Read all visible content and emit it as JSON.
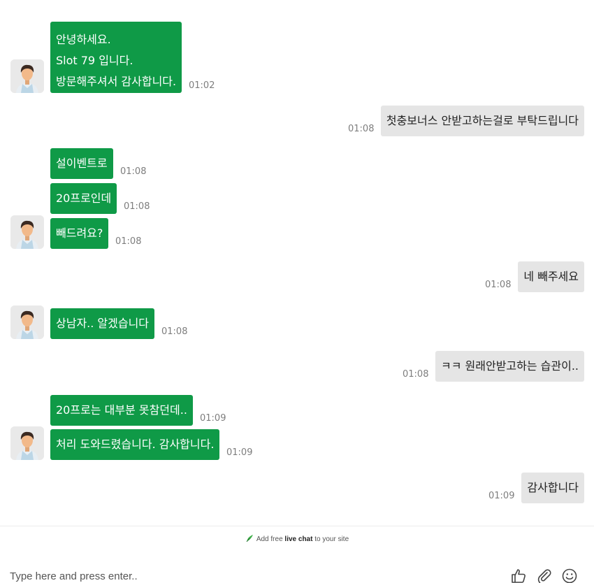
{
  "messages": [
    {
      "from": "agent",
      "lines": [
        "안녕하세요.",
        "Slot 79 입니다.",
        "방문해주셔서 감사합니다."
      ],
      "time": "01:02",
      "avatar": "agent-avatar"
    },
    {
      "from": "visitor",
      "lines": [
        "첫충보너스 안받고하는걸로 부탁드립니다"
      ],
      "time": "01:08"
    },
    {
      "from": "agent",
      "lines": [
        "설이벤트로"
      ],
      "time": "01:08"
    },
    {
      "from": "agent",
      "lines": [
        "20프로인데"
      ],
      "time": "01:08"
    },
    {
      "from": "agent",
      "lines": [
        "빼드려요?"
      ],
      "time": "01:08",
      "avatar": "agent-avatar"
    },
    {
      "from": "visitor",
      "lines": [
        "네 빼주세요"
      ],
      "time": "01:08"
    },
    {
      "from": "agent",
      "lines": [
        "상남자.. 알겠습니다"
      ],
      "time": "01:08",
      "avatar": "agent-avatar"
    },
    {
      "from": "visitor",
      "lines": [
        "ㅋㅋ 원래안받고하는 습관이.."
      ],
      "time": "01:08"
    },
    {
      "from": "agent",
      "lines": [
        "20프로는 대부분 못참던데.."
      ],
      "time": "01:09"
    },
    {
      "from": "agent",
      "lines": [
        "처리 도와드렸습니다. 감사합니다."
      ],
      "time": "01:09",
      "avatar": "agent-avatar"
    },
    {
      "from": "visitor",
      "lines": [
        "감사합니다"
      ],
      "time": "01:09"
    }
  ],
  "branding": {
    "prefix": "Add free",
    "bold": "live chat",
    "suffix": "to your site"
  },
  "composer": {
    "placeholder": "Type here and press enter..",
    "icons": [
      "thumbs-up-icon",
      "paperclip-icon",
      "emoji-icon"
    ]
  },
  "colors": {
    "agent_bubble": "#0f9a47",
    "visitor_bubble": "#e5e5e5"
  }
}
